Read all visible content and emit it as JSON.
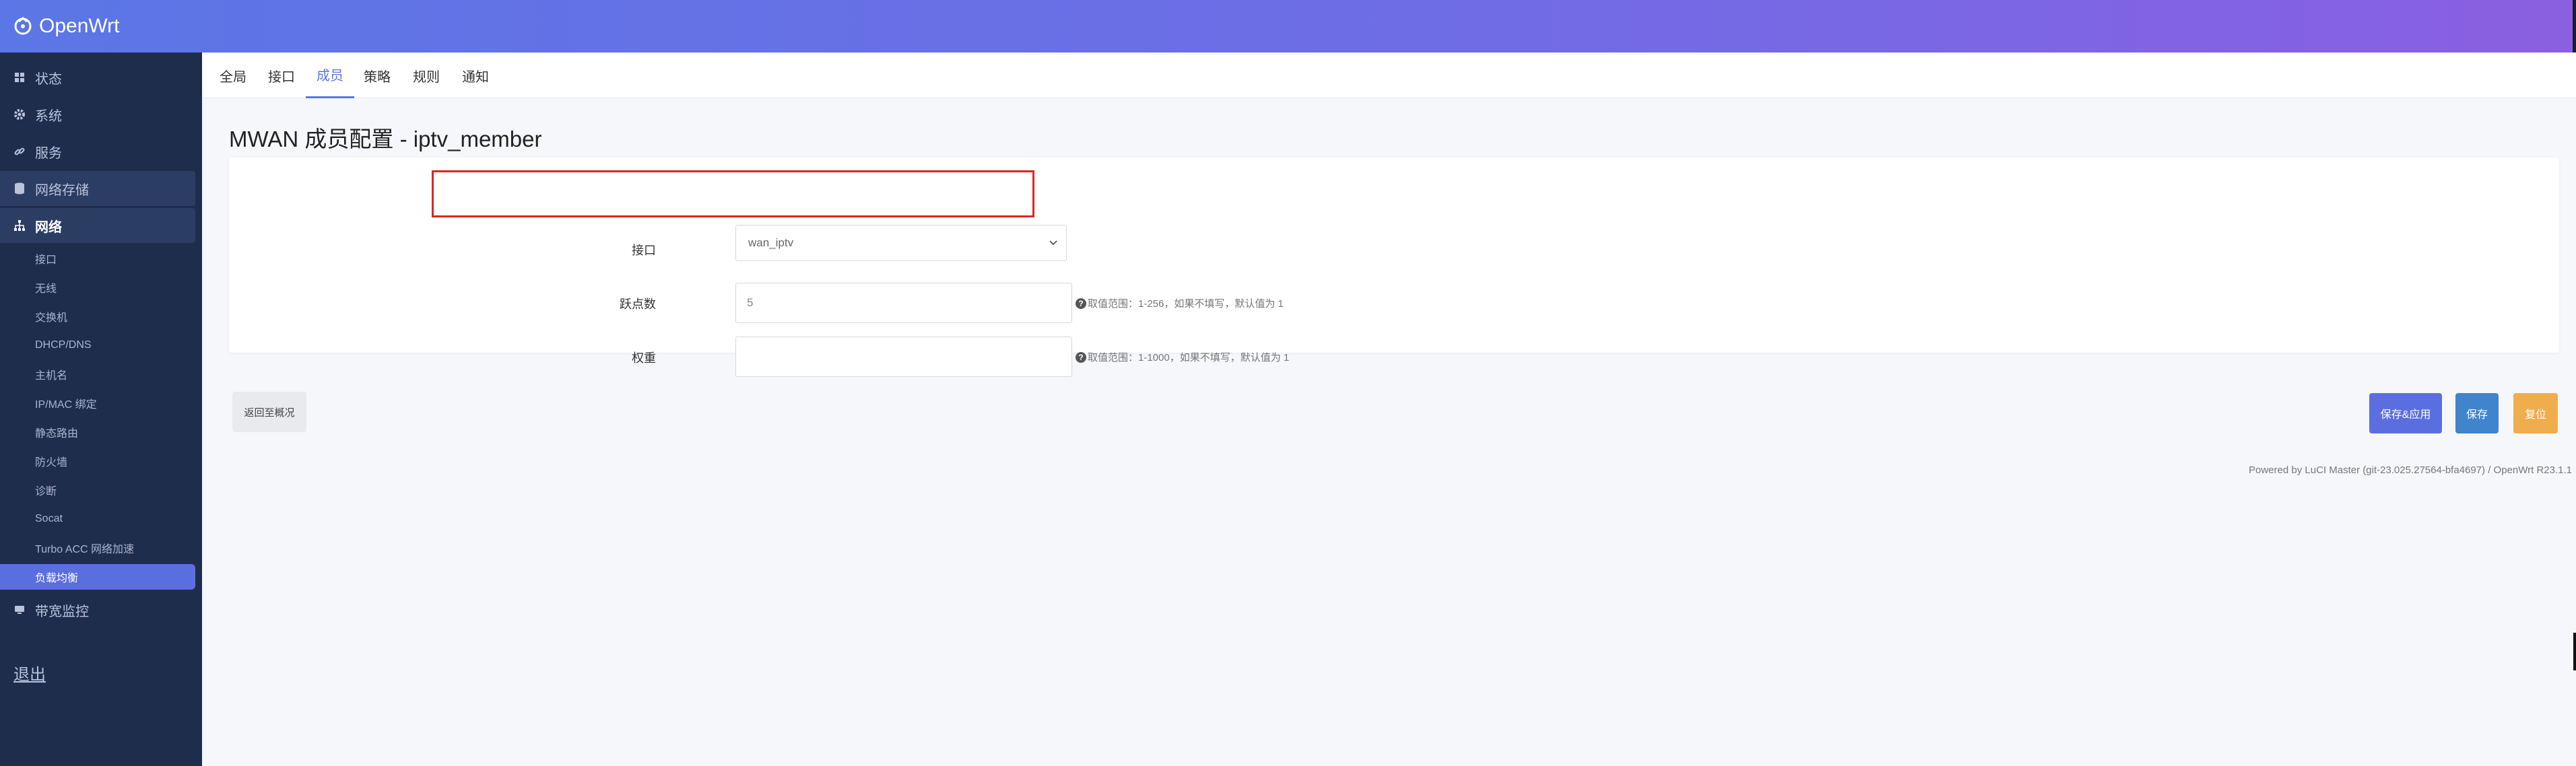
{
  "header": {
    "brand": "OpenWrt"
  },
  "sidebar": {
    "items": [
      {
        "label": "状态",
        "icon": "dashboard-icon"
      },
      {
        "label": "系统",
        "icon": "gear-icon"
      },
      {
        "label": "服务",
        "icon": "link-icon"
      },
      {
        "label": "网络存储",
        "icon": "storage-icon"
      },
      {
        "label": "网络",
        "icon": "network-icon"
      },
      {
        "label": "带宽监控",
        "icon": "monitor-icon"
      }
    ],
    "network_sub": [
      "接口",
      "无线",
      "交换机",
      "DHCP/DNS",
      "主机名",
      "IP/MAC 绑定",
      "静态路由",
      "防火墙",
      "诊断",
      "Socat",
      "Turbo ACC 网络加速",
      "负载均衡"
    ],
    "logout": "退出"
  },
  "tabs": [
    "全局",
    "接口",
    "成员",
    "策略",
    "规则",
    "通知"
  ],
  "active_tab": "成员",
  "page": {
    "title": "MWAN 成员配置 - iptv_member",
    "fields": {
      "interface": {
        "label": "接口",
        "value": "wan_iptv"
      },
      "metric": {
        "label": "跃点数",
        "value": "5",
        "hint": "取值范围：1-256，如果不填写，默认值为 1"
      },
      "weight": {
        "label": "权重",
        "value": "",
        "hint": "取值范围：1-1000，如果不填写，默认值为 1"
      }
    }
  },
  "buttons": {
    "back": "返回至概况",
    "save_apply": "保存&应用",
    "save": "保存",
    "reset": "复位"
  },
  "footer": "Powered by LuCI Master (git-23.025.27564-bfa4697) / OpenWrt R23.1.1",
  "colors": {
    "accent": "#5b76e6",
    "sidebar_bg": "#1f2d4d",
    "highlight": "#e02424",
    "reset": "#f0ad4e"
  }
}
